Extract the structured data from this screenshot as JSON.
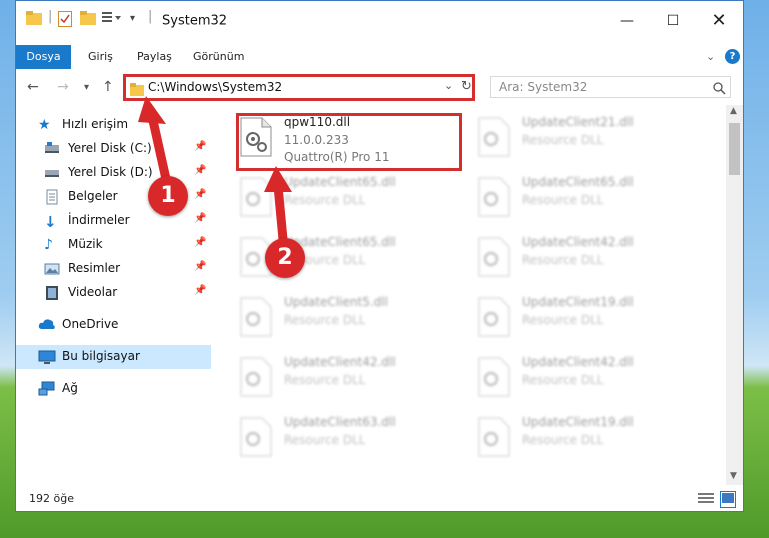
{
  "window": {
    "title": "System32"
  },
  "ribbon": {
    "tabs": [
      "Dosya",
      "Giriş",
      "Paylaş",
      "Görünüm"
    ]
  },
  "address": {
    "path": "C:\\Windows\\System32"
  },
  "search": {
    "placeholder": "Ara: System32"
  },
  "sidebar": {
    "items": [
      {
        "label": "Hızlı erişim"
      },
      {
        "label": "Yerel Disk (C:)"
      },
      {
        "label": "Yerel Disk (D:)"
      },
      {
        "label": "Belgeler"
      },
      {
        "label": "İndirmeler"
      },
      {
        "label": "Müzik"
      },
      {
        "label": "Resimler"
      },
      {
        "label": "Videolar"
      },
      {
        "label": "OneDrive"
      },
      {
        "label": "Bu bilgisayar"
      },
      {
        "label": "Ağ"
      }
    ]
  },
  "files": [
    {
      "name": "qpw110.dll",
      "line1": "11.0.0.233",
      "line2": "Quattro(R) Pro 11"
    },
    {
      "name": "UpdateClient21.dll",
      "line1": "Resource DLL"
    },
    {
      "name": "UpdateClient65.dll",
      "line1": "Resource DLL"
    },
    {
      "name": "UpdateClient65.dll",
      "line1": "Resource DLL"
    },
    {
      "name": "UpdateClient65.dll",
      "line1": "Resource DLL"
    },
    {
      "name": "UpdateClient42.dll",
      "line1": "Resource DLL"
    },
    {
      "name": "UpdateClient5.dll",
      "line1": "Resource DLL"
    },
    {
      "name": "UpdateClient19.dll",
      "line1": "Resource DLL"
    },
    {
      "name": "UpdateClient42.dll",
      "line1": "Resource DLL"
    },
    {
      "name": "UpdateClient42.dll",
      "line1": "Resource DLL"
    },
    {
      "name": "UpdateClient63.dll",
      "line1": "Resource DLL"
    },
    {
      "name": "UpdateClient19.dll",
      "line1": "Resource DLL"
    }
  ],
  "status": {
    "count": "192 öğe"
  },
  "markers": [
    "1",
    "2"
  ],
  "colors": {
    "accent": "#1979ca",
    "highlight": "#d32f2f",
    "marker": "#d9282a"
  }
}
